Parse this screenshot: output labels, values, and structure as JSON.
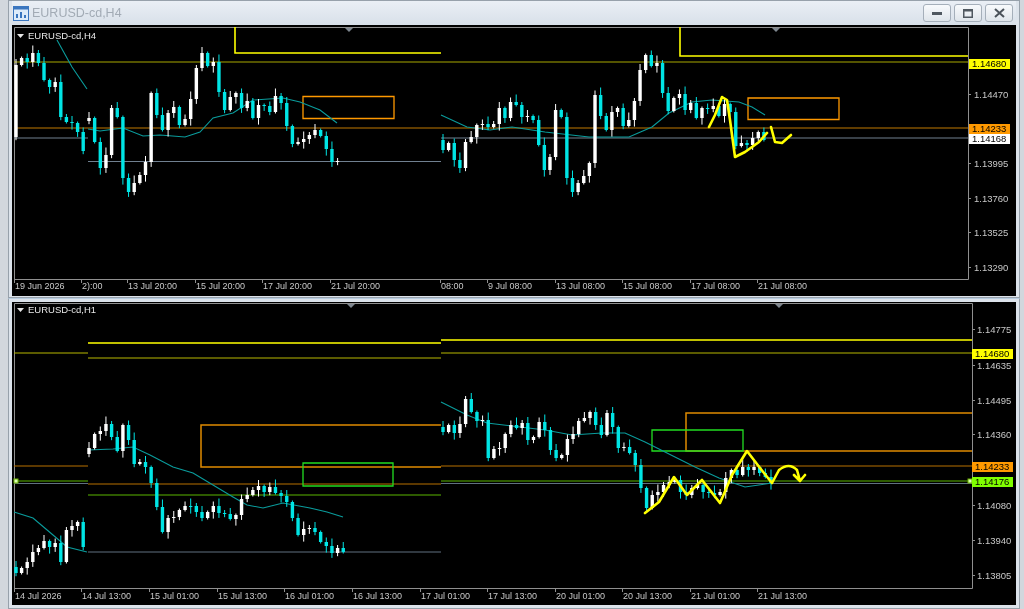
{
  "window": {
    "title": "EURUSD-cd,H4",
    "active": false
  },
  "window_buttons": [
    {
      "kind": "minimize"
    },
    {
      "kind": "maximize"
    },
    {
      "kind": "close"
    }
  ],
  "charts": [
    {
      "label": "EURUSD-cd,H4",
      "price_ticks": [
        "1.14470",
        "1.13995",
        "1.13760",
        "1.13525",
        "1.13290"
      ],
      "price_badges": [
        {
          "text": "1.14680",
          "color": "#ffff00"
        },
        {
          "text": "1.14233",
          "color": "#ff9900"
        },
        {
          "text": "1.14168",
          "color": "#ffffff"
        }
      ],
      "time_ticks": [
        "19 Jun 2026",
        "2):00",
        "13 Jul 20:00",
        "15 Jul 20:00",
        "17 Jul 20:00",
        "21 Jul 20:00",
        "08:00",
        "9 Jul 08:00",
        "13 Jul 08:00",
        "15 Jul 08:00",
        "17 Jul 08:00",
        "21 Jul 08:00"
      ]
    },
    {
      "label": "EURUSD-cd,H1",
      "price_ticks": [
        "1.14775",
        "1.14635",
        "1.14495",
        "1.14360",
        "1.14080",
        "1.13940",
        "1.13805"
      ],
      "price_badges": [
        {
          "text": "1.14680",
          "color": "#ffff00"
        },
        {
          "text": "1.14233",
          "color": "#ff9900"
        },
        {
          "text": "1.14176",
          "color": "#80ff00"
        }
      ],
      "time_ticks": [
        "14 Jul 2026",
        "14 Jul 13:00",
        "15 Jul 01:00",
        "15 Jul 13:00",
        "16 Jul 01:00",
        "16 Jul 13:00",
        "17 Jul 01:00",
        "17 Jul 13:00",
        "20 Jul 01:00",
        "20 Jul 13:00",
        "21 Jul 01:00",
        "21 Jul 13:00"
      ]
    }
  ]
}
